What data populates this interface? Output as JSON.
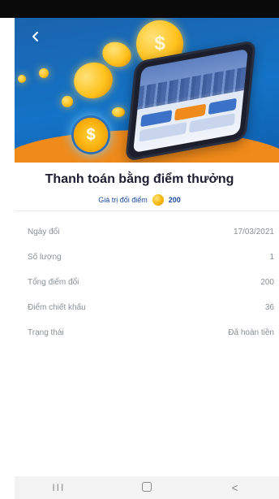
{
  "header": {
    "back_icon": "chevron-left-icon"
  },
  "banner": {
    "coin_symbol": "$",
    "badge_symbol": "$",
    "colors": {
      "background": "#1473c6",
      "accent": "#f08a1a",
      "coin": "#ffc21e"
    }
  },
  "transaction": {
    "title": "Thanh toán bằng điểm thưởng",
    "points_label": "Giá trị đổi điểm",
    "points_value": "200",
    "points_icon": "gold-coin-icon"
  },
  "details": [
    {
      "label": "Ngày đổi",
      "value": "17/03/2021"
    },
    {
      "label": "Số lượng",
      "value": "1"
    },
    {
      "label": "Tổng điểm đổi",
      "value": "200"
    },
    {
      "label": "Điểm chiết khấu",
      "value": "36"
    },
    {
      "label": "Trạng thái",
      "value": "Đã hoàn tiền"
    }
  ],
  "system_nav": {
    "recent_glyph": "III",
    "back_glyph": "<"
  }
}
